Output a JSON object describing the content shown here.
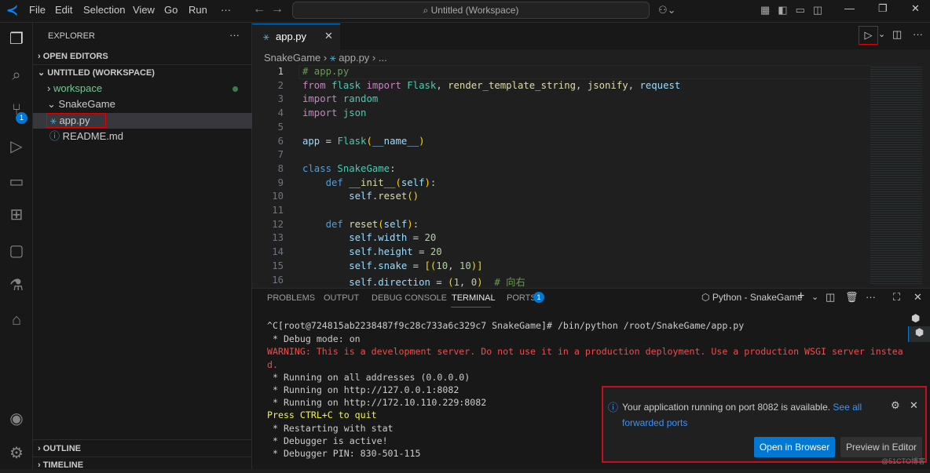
{
  "titlebar": {
    "menu": [
      "File",
      "Edit",
      "Selection",
      "View",
      "Go",
      "Run",
      "···"
    ],
    "search": "Untitled (Workspace)"
  },
  "activity": {
    "scm_badge": "1"
  },
  "sidebar": {
    "title": "EXPLORER",
    "open_editors": "OPEN EDITORS",
    "workspace": "UNTITLED (WORKSPACE)",
    "items": [
      {
        "label": "workspace"
      },
      {
        "label": "SnakeGame"
      },
      {
        "label": "app.py"
      },
      {
        "label": "README.md"
      }
    ],
    "outline": "OUTLINE",
    "timeline": "TIMELINE"
  },
  "editor": {
    "tab": "app.py",
    "breadcrumb": {
      "folder": "SnakeGame",
      "file": "app.py",
      "more": "..."
    },
    "lines": [
      [
        [
          "# app.py",
          "c"
        ]
      ],
      [
        [
          "from ",
          "k"
        ],
        [
          "flask ",
          "m"
        ],
        [
          "import ",
          "k"
        ],
        [
          "Flask",
          "m"
        ],
        [
          ", ",
          "p"
        ],
        [
          "render_template_string",
          "f"
        ],
        [
          ", ",
          "p"
        ],
        [
          "jsonify",
          "f"
        ],
        [
          ", ",
          "p"
        ],
        [
          "request",
          "v"
        ]
      ],
      [
        [
          "import ",
          "k"
        ],
        [
          "random",
          "m"
        ]
      ],
      [
        [
          "import ",
          "k"
        ],
        [
          "json",
          "m"
        ]
      ],
      [],
      [
        [
          "app ",
          "v"
        ],
        [
          "= ",
          "p"
        ],
        [
          "Flask",
          "m"
        ],
        [
          "(",
          "y"
        ],
        [
          "__name__",
          "v"
        ],
        [
          ")",
          "y"
        ]
      ],
      [],
      [
        [
          "class ",
          "b"
        ],
        [
          "SnakeGame",
          "m"
        ],
        [
          ":",
          "p"
        ]
      ],
      [
        [
          "    def ",
          "b"
        ],
        [
          "__init__",
          "f"
        ],
        [
          "(",
          "y"
        ],
        [
          "self",
          "v"
        ],
        [
          ")",
          "y"
        ],
        [
          ":",
          "p"
        ]
      ],
      [
        [
          "        self",
          "v"
        ],
        [
          ".",
          "p"
        ],
        [
          "reset",
          "f"
        ],
        [
          "()",
          "y"
        ]
      ],
      [],
      [
        [
          "    def ",
          "b"
        ],
        [
          "reset",
          "f"
        ],
        [
          "(",
          "y"
        ],
        [
          "self",
          "v"
        ],
        [
          ")",
          "y"
        ],
        [
          ":",
          "p"
        ]
      ],
      [
        [
          "        self",
          "v"
        ],
        [
          ".width ",
          "v"
        ],
        [
          "= ",
          "p"
        ],
        [
          "20",
          "n"
        ]
      ],
      [
        [
          "        self",
          "v"
        ],
        [
          ".height ",
          "v"
        ],
        [
          "= ",
          "p"
        ],
        [
          "20",
          "n"
        ]
      ],
      [
        [
          "        self",
          "v"
        ],
        [
          ".snake ",
          "v"
        ],
        [
          "= ",
          "p"
        ],
        [
          "[(",
          "y"
        ],
        [
          "10",
          "n"
        ],
        [
          ", ",
          "p"
        ],
        [
          "10",
          "n"
        ],
        [
          ")]",
          "y"
        ]
      ],
      [
        [
          "        self",
          "v"
        ],
        [
          ".direction ",
          "v"
        ],
        [
          "= ",
          "p"
        ],
        [
          "(",
          "y"
        ],
        [
          "1",
          "n"
        ],
        [
          ", ",
          "p"
        ],
        [
          "0",
          "n"
        ],
        [
          ")",
          "y"
        ],
        [
          "  # 向右",
          "c"
        ]
      ]
    ]
  },
  "panel": {
    "tabs": [
      "PROBLEMS",
      "OUTPUT",
      "DEBUG CONSOLE",
      "TERMINAL",
      "PORTS"
    ],
    "ports_badge": "1",
    "terminal_name": "Python - SnakeGame",
    "terminal": [
      {
        "t": "^C[root@724815ab2238487f9c28c733a6c329c7 SnakeGame]# /bin/python /root/SnakeGame/app.py",
        "c": "#ccc"
      },
      {
        "t": " * Debug mode: on",
        "c": "#ccc"
      },
      {
        "t": "WARNING: This is a development server. Do not use it in a production deployment. Use a production WSGI server instea",
        "c": "#f14c4c"
      },
      {
        "t": "d.",
        "c": "#f14c4c"
      },
      {
        "t": " * Running on all addresses (0.0.0.0)",
        "c": "#ccc"
      },
      {
        "t": " * Running on http://127.0.0.1:8082",
        "c": "#ccc"
      },
      {
        "t": " * Running on http://172.10.110.229:8082",
        "c": "#ccc"
      },
      {
        "t": "Press CTRL+C to quit",
        "c": "#f5f543"
      },
      {
        "t": " * Restarting with stat",
        "c": "#ccc"
      },
      {
        "t": " * Debugger is active!",
        "c": "#ccc"
      },
      {
        "t": " * Debugger PIN: 830-501-115",
        "c": "#ccc"
      }
    ]
  },
  "notification": {
    "message": "Your application running on port 8082 is available.",
    "link1": "See all",
    "link2": "forwarded ports",
    "primary": "Open in Browser",
    "secondary": "Preview in Editor"
  },
  "watermark": "@51CTO博客"
}
